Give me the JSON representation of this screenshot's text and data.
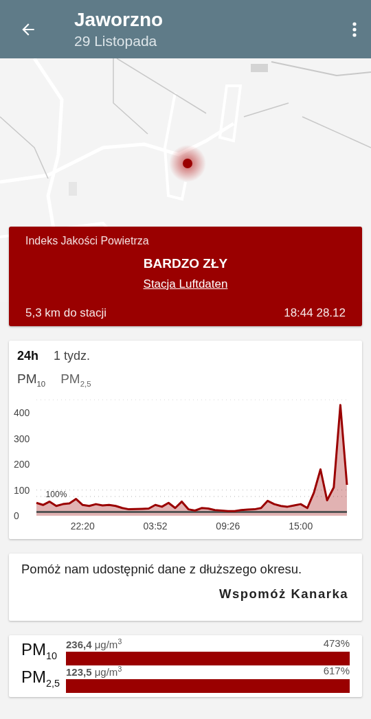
{
  "app_bar": {
    "title": "Jaworzno",
    "subtitle": "29 Listopada"
  },
  "index_card": {
    "heading": "Indeks Jakości Powietrza",
    "level_text": "BARDZO ZŁY",
    "station_link": "Stacja Luftdaten",
    "distance": "5,3 km do stacji",
    "timestamp": "18:44 28.12"
  },
  "chart_card": {
    "range_tabs": [
      {
        "label": "24h",
        "selected": true
      },
      {
        "label": "1 tydz.",
        "selected": false
      }
    ],
    "pollutant_tabs": [
      {
        "label": "PM$_{10}$",
        "selected": true
      },
      {
        "label": "PM$_{2,5}$",
        "selected": false
      }
    ],
    "chart_data": {
      "type": "area",
      "categories": [
        null,
        null,
        null,
        null,
        null,
        null,
        null,
        "22:20",
        null,
        null,
        null,
        null,
        null,
        null,
        null,
        null,
        null,
        null,
        "03:52",
        null,
        null,
        null,
        null,
        null,
        null,
        null,
        null,
        null,
        null,
        "09:26",
        null,
        null,
        null,
        null,
        null,
        null,
        null,
        null,
        null,
        null,
        "15:00",
        null,
        null,
        null,
        null,
        null,
        null,
        null
      ],
      "series": [
        {
          "color": "#9a0000",
          "values": [
            50,
            42,
            55,
            38,
            45,
            48,
            65,
            42,
            38,
            45,
            40,
            42,
            38,
            30,
            25,
            26,
            27,
            28,
            42,
            35,
            50,
            30,
            55,
            25,
            20,
            30,
            28,
            22,
            20,
            18,
            18,
            22,
            24,
            25,
            30,
            58,
            45,
            38,
            35,
            40,
            45,
            30,
            90,
            180,
            60,
            110,
            430,
            120
          ]
        },
        {
          "type": "line",
          "color": "#555555",
          "values": [
            15,
            15,
            15,
            15,
            15,
            15,
            15,
            15,
            15,
            15,
            15,
            15,
            15,
            15,
            15,
            15,
            15,
            15,
            15,
            15,
            15,
            15,
            15,
            15,
            15,
            15,
            15,
            15,
            15,
            15,
            15,
            15,
            15,
            15,
            15,
            15,
            15,
            15,
            15,
            15,
            15,
            15,
            15,
            15,
            15,
            15,
            15,
            15
          ]
        }
      ],
      "ylim": [
        0,
        450
      ],
      "yticks": [
        0,
        100,
        200,
        300,
        400
      ],
      "annotations": [
        {
          "y": 50,
          "text": "100%"
        }
      ]
    }
  },
  "promo_card": {
    "message": "Pomóż nam udostępnić dane z dłuższego okresu.",
    "action": "Wspomóż Kanarka"
  },
  "measurements": [
    {
      "name": "PM$_{10}$",
      "value": "**236,4** μg/m$^{3}$",
      "percent": "473%",
      "level": 1
    },
    {
      "name": "PM$_{2,5}$",
      "value": "**123,5** μg/m$^{3}$",
      "percent": "617%",
      "level": 1
    }
  ]
}
